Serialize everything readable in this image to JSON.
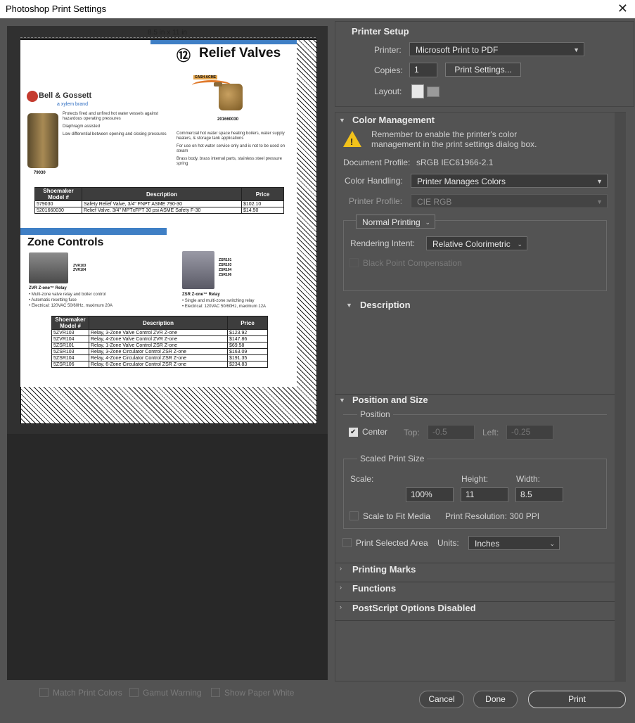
{
  "window": {
    "title": "Photoshop Print Settings",
    "close_label": "✕"
  },
  "preview": {
    "paper_size": "8.5 in x 11 in"
  },
  "doc": {
    "title_number": "⑫",
    "title": "Relief Valves",
    "cash_acme": "CASH ACME",
    "brand": "Bell & Gossett",
    "brand_sub": "a xylem brand",
    "part_left": "79030",
    "part_right": "201660030",
    "bullets_left": [
      "Protects fired and unfired hot water vessels against hazardous operating pressures",
      "Diaphragm assisted",
      "Low differential between opening and closing pressures"
    ],
    "bullets_right": [
      "Commercial hot water space heating boilers, water supply heaters, & storage tank applications",
      "For use on hot water service only and is not to be used on steam",
      "Brass body, brass internal parts, stainless steel pressure spring"
    ],
    "table1": {
      "headers": [
        "Shoemaker Model #",
        "Description",
        "Price"
      ],
      "rows": [
        [
          "579030",
          "Safety Relief Valve, 3/4\" FNPT ASME 790-30",
          "$102.10"
        ],
        [
          "5201660030",
          "Relief Valve, 3/4\" MPTxFPT 30 psi ASME Safety F-30",
          "$14.50"
        ]
      ]
    },
    "section2": "Zone Controls",
    "zvr_models": "ZVR103\nZVR104",
    "zsr_models": "ZSR101\nZSR103\nZSR104\nZSR106",
    "zvr_title": "ZVR Z-one™ Relay",
    "zvr_lines": [
      "• Multi-zone valve relay and boiler control",
      "• Automatic resetting fuse",
      "• Electrical: 120VAC 50/60Hz, maximum 20A"
    ],
    "zsr_title": "ZSR Z-one™ Relay",
    "zsr_lines": [
      "• Single and multi-zone switching relay",
      "• Electrical: 120VAC 50/60Hz, maximum 12A"
    ],
    "table2": {
      "headers": [
        "Shoemaker Model #",
        "Description",
        "Price"
      ],
      "rows": [
        [
          "5ZVR103",
          "Relay, 3-Zone Valve Control ZVR Z-one",
          "$123.92"
        ],
        [
          "5ZVR104",
          "Relay, 4-Zone Valve Control ZVR Z-one",
          "$147.86"
        ],
        [
          "5ZSR101",
          "Relay, 1-Zone Valve Control ZSR Z-one",
          "$69.58"
        ],
        [
          "5ZSR103",
          "Relay, 3-Zone Circulator Control ZSR Z-one",
          "$163.09"
        ],
        [
          "5ZSR104",
          "Relay, 4-Zone Circulator Control ZSR Z-one",
          "$191.35"
        ],
        [
          "5ZSR106",
          "Relay, 6-Zone Circulator Control ZSR Z-one",
          "$234.83"
        ]
      ]
    }
  },
  "bottom_left": {
    "match_print_colors": "Match Print Colors",
    "gamut_warning": "Gamut Warning",
    "show_paper_white": "Show Paper White"
  },
  "printer_setup": {
    "header": "Printer Setup",
    "printer_label": "Printer:",
    "printer_value": "Microsoft Print to PDF",
    "copies_label": "Copies:",
    "copies_value": "1",
    "print_settings_button": "Print Settings...",
    "layout_label": "Layout:"
  },
  "color_management": {
    "header": "Color Management",
    "warning": "Remember to enable the printer's color management in the print settings dialog box.",
    "doc_profile_label": "Document Profile:",
    "doc_profile_value": "sRGB IEC61966-2.1",
    "color_handling_label": "Color Handling:",
    "color_handling_value": "Printer Manages Colors",
    "printer_profile_label": "Printer Profile:",
    "printer_profile_value": "CIE RGB",
    "normal_printing": "Normal Printing",
    "rendering_intent_label": "Rendering Intent:",
    "rendering_intent_value": "Relative Colorimetric",
    "bpc_label": "Black Point Compensation"
  },
  "description": {
    "header": "Description"
  },
  "position_size": {
    "header": "Position and Size",
    "position_label": "Position",
    "center_label": "Center",
    "top_label": "Top:",
    "top_value": "-0.5",
    "left_label": "Left:",
    "left_value": "-0.25",
    "scaled_label": "Scaled Print Size",
    "scale_label": "Scale:",
    "scale_value": "100%",
    "height_label": "Height:",
    "height_value": "11",
    "width_label": "Width:",
    "width_value": "8.5",
    "fit_label": "Scale to Fit Media",
    "resolution": "Print Resolution: 300 PPI",
    "selected_area_label": "Print Selected Area",
    "units_label": "Units:",
    "units_value": "Inches"
  },
  "sections": {
    "printing_marks": "Printing Marks",
    "functions": "Functions",
    "postscript": "PostScript Options Disabled"
  },
  "buttons": {
    "cancel": "Cancel",
    "done": "Done",
    "print": "Print"
  }
}
